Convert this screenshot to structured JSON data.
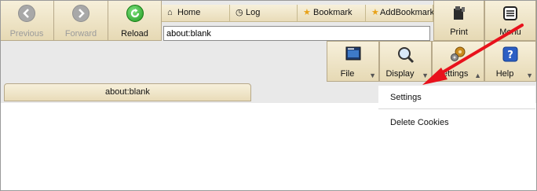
{
  "nav": {
    "previous_label": "Previous",
    "forward_label": "Forward",
    "reload_label": "Reload"
  },
  "bookmarks": {
    "home": {
      "icon": "home-icon",
      "label": "Home"
    },
    "log": {
      "icon": "clock-icon",
      "label": "Log"
    },
    "bookmark": {
      "icon": "star-icon",
      "label": "Bookmark"
    },
    "add_bookmark": {
      "icon": "add-star-icon",
      "label": "AddBookmark"
    }
  },
  "address": {
    "value": "about:blank"
  },
  "actions": {
    "print_label": "Print",
    "menu_label": "Menu"
  },
  "menus": {
    "file_label": "File",
    "display_label": "Display",
    "settings_label": "Settings",
    "help_label": "Help"
  },
  "tab": {
    "title": "about:blank"
  },
  "dropdown": {
    "items": [
      "Settings",
      "Delete Cookies"
    ]
  },
  "colors": {
    "annotation_arrow": "#e8121c",
    "reload_green": "#1e9a1e",
    "button_beige": "#eee4c8"
  }
}
